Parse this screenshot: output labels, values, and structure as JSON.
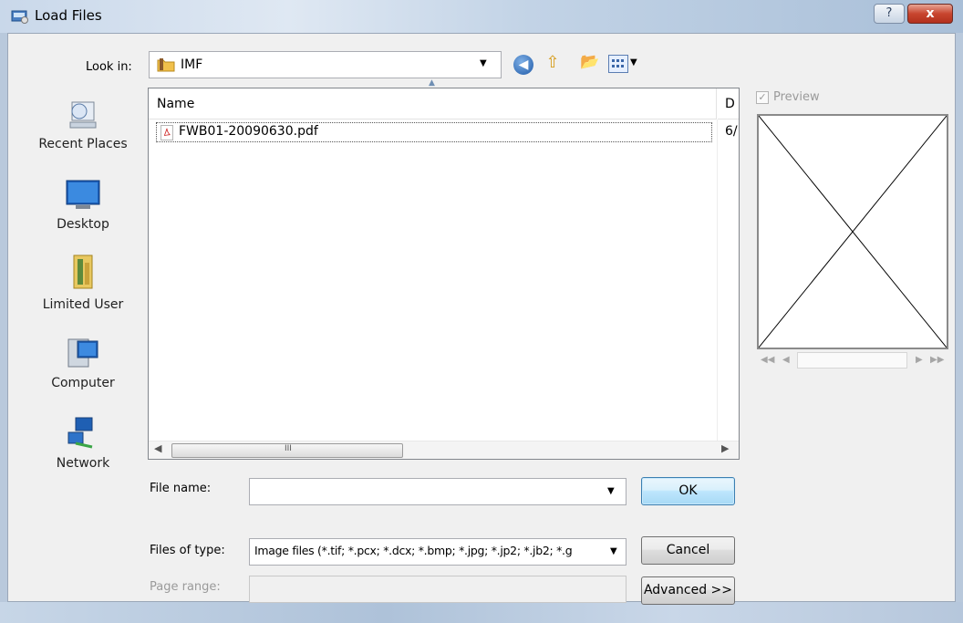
{
  "window": {
    "title": "Load Files",
    "help_label": "?",
    "close_label": "x"
  },
  "look_in": {
    "label": "Look in:",
    "value": "IMF"
  },
  "places": [
    {
      "label": "Recent Places",
      "icon": "recent-places-icon"
    },
    {
      "label": "Desktop",
      "icon": "desktop-icon"
    },
    {
      "label": "Limited User",
      "icon": "user-folder-icon"
    },
    {
      "label": "Computer",
      "icon": "computer-icon"
    },
    {
      "label": "Network",
      "icon": "network-icon"
    }
  ],
  "file_list": {
    "columns": [
      "Name",
      "D"
    ],
    "rows": [
      {
        "name": "FWB01-20090630.pdf",
        "date": "6/"
      }
    ],
    "scroll_grip": "III"
  },
  "file_name": {
    "label": "File name:",
    "value": ""
  },
  "files_of_type": {
    "label": "Files of type:",
    "value": "Image files (*.tif; *.pcx; *.dcx; *.bmp; *.jpg; *.jp2; *.jb2; *.g"
  },
  "page_range": {
    "label": "Page range:",
    "value": ""
  },
  "buttons": {
    "ok": "OK",
    "cancel": "Cancel",
    "advanced": "Advanced >>"
  },
  "preview": {
    "label": "Preview",
    "checked": true
  }
}
